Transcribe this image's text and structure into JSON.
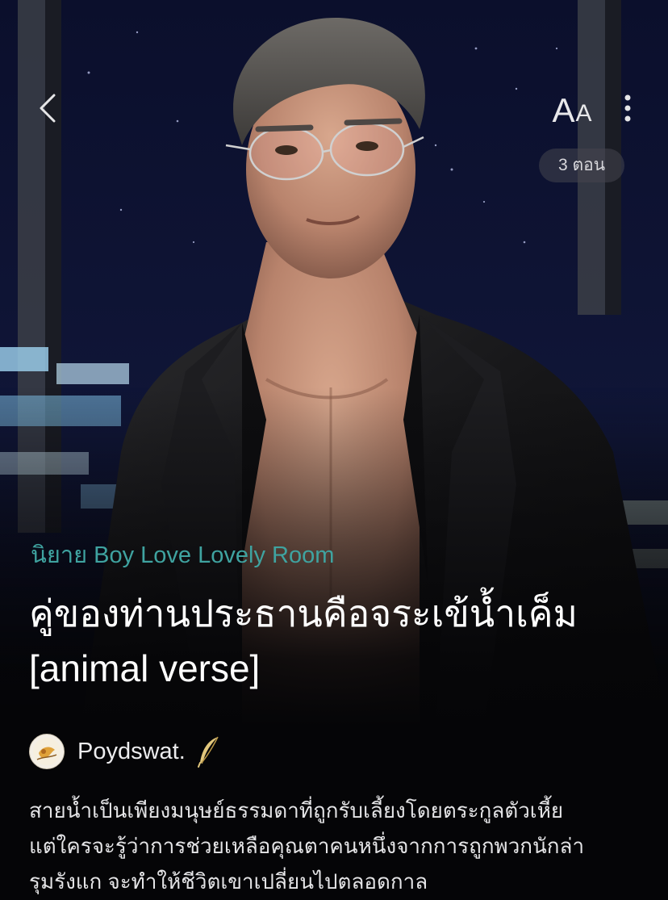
{
  "header": {
    "font_size_label_big": "A",
    "font_size_label_small": "A",
    "episode_count": "3 ตอน"
  },
  "book": {
    "category": "นิยาย Boy Love Lovely Room",
    "title_line1": "คู่ของท่านประธานคือจระเข้น้ำเค็ม",
    "title_line2": "[animal verse]",
    "author": "Poydswat.",
    "synopsis_line1": "สายน้ำเป็นเพียงมนุษย์ธรรมดาที่ถูกรับเลี้ยงโดยตระกูลตัวเหี้ย",
    "synopsis_line2": "แต่ใครจะรู้ว่าการช่วยเหลือคุณตาคนหนึ่งจากการถูกพวกนักล่า",
    "synopsis_line3": "รุมรังแก จะทำให้ชีวิตเขาเปลี่ยนไปตลอดกาล"
  },
  "icons": {
    "back": "chevron-left-icon",
    "font_size": "font-size-icon",
    "more": "more-vertical-icon",
    "writer_badge": "feather-icon"
  },
  "colors": {
    "category_text": "#3fa3a0",
    "background": "#050507",
    "badge_bg": "#46464e"
  }
}
